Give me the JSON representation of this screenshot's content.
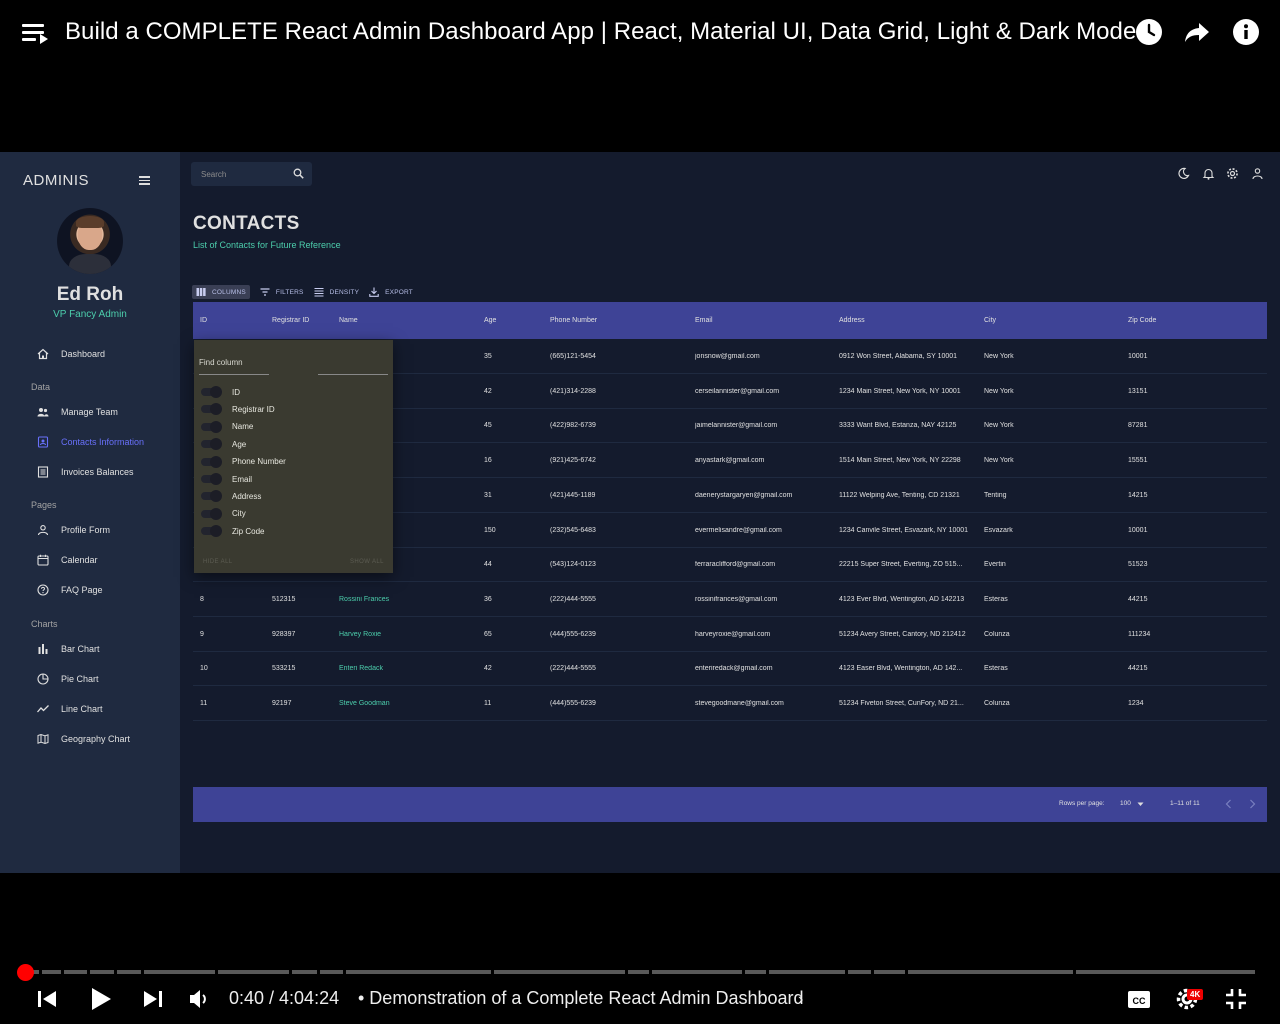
{
  "video": {
    "title": "Build a COMPLETE React Admin Dashboard App | React, Material UI, Data Grid, Light & Dark Mode",
    "current_time": "0:40",
    "duration": "4:04:24",
    "time_display": "0:40 / 4:04:24",
    "chapter": "• Demonstration of a Complete React Admin Dashboard",
    "chapter_chevron": "›",
    "quality_badge": "4K",
    "progress_fraction": 0.003,
    "accent_color": "#ff0000"
  },
  "app": {
    "brand": "ADMINIS",
    "user": {
      "name": "Ed Roh",
      "role": "VP Fancy Admin"
    },
    "nav": {
      "dashboard": "Dashboard",
      "section_data": "Data",
      "manage_team": "Manage Team",
      "contacts_information": "Contacts Information",
      "invoices_balances": "Invoices Balances",
      "section_pages": "Pages",
      "profile_form": "Profile Form",
      "calendar": "Calendar",
      "faq_page": "FAQ Page",
      "section_charts": "Charts",
      "bar_chart": "Bar Chart",
      "pie_chart": "Pie Chart",
      "line_chart": "Line Chart",
      "geography_chart": "Geography Chart"
    },
    "search": {
      "placeholder": "Search"
    },
    "page": {
      "title": "CONTACTS",
      "subtitle": "List of Contacts for Future Reference"
    },
    "toolbar": {
      "columns": "COLUMNS",
      "filters": "FILTERS",
      "density": "DENSITY",
      "export": "EXPORT"
    },
    "columns": [
      "ID",
      "Registrar ID",
      "Name",
      "Age",
      "Phone Number",
      "Email",
      "Address",
      "City",
      "Zip Code"
    ],
    "rows": [
      [
        "",
        "",
        "",
        "35",
        "(665)121-5454",
        "jonsnow@gmail.com",
        "0912 Won Street, Alabama, SY 10001",
        "New York",
        "10001"
      ],
      [
        "",
        "",
        "",
        "42",
        "(421)314-2288",
        "cerseilannister@gmail.com",
        "1234 Main Street, New York, NY 10001",
        "New York",
        "13151"
      ],
      [
        "",
        "",
        "",
        "45",
        "(422)982-6739",
        "jaimelannister@gmail.com",
        "3333 Want Blvd, Estanza, NAY 42125",
        "New York",
        "87281"
      ],
      [
        "",
        "",
        "",
        "16",
        "(921)425-6742",
        "anyastark@gmail.com",
        "1514 Main Street, New York, NY 22298",
        "New York",
        "15551"
      ],
      [
        "",
        "",
        "yen",
        "31",
        "(421)445-1189",
        "daenerystargaryen@gmail.com",
        "11122 Welping Ave, Tenting, CD 21321",
        "Tenting",
        "14215"
      ],
      [
        "",
        "",
        "",
        "150",
        "(232)545-6483",
        "evermelisandre@gmail.com",
        "1234 Canvile Street, Esvazark, NY 10001",
        "Esvazark",
        "10001"
      ],
      [
        "",
        "",
        "",
        "44",
        "(543)124-0123",
        "ferraraclifford@gmail.com",
        "22215 Super Street, Everting, ZO 515...",
        "Evertin",
        "51523"
      ],
      [
        "8",
        "512315",
        "Rossini Frances",
        "36",
        "(222)444-5555",
        "rossinifrances@gmail.com",
        "4123 Ever Blvd, Wentington, AD 142213",
        "Esteras",
        "44215"
      ],
      [
        "9",
        "928397",
        "Harvey Roxie",
        "65",
        "(444)555-6239",
        "harveyroxie@gmail.com",
        "51234 Avery Street, Cantory, ND 212412",
        "Colunza",
        "111234"
      ],
      [
        "10",
        "533215",
        "Enteri Redack",
        "42",
        "(222)444-5555",
        "enteriredack@gmail.com",
        "4123 Easer Blvd, Wentington, AD 142...",
        "Esteras",
        "44215"
      ],
      [
        "11",
        "92197",
        "Steve Goodman",
        "11",
        "(444)555-6239",
        "stevegoodmane@gmail.com",
        "51234 Fiveton Street, CunFory, ND 21...",
        "Colunza",
        "1234"
      ]
    ],
    "footer": {
      "rows_per_page_label": "Rows per page:",
      "rows_per_page": "100",
      "range": "1–11 of 11"
    },
    "column_panel": {
      "find_placeholder": "Find column",
      "options": [
        "ID",
        "Registrar ID",
        "Name",
        "Age",
        "Phone Number",
        "Email",
        "Address",
        "City",
        "Zip Code"
      ],
      "hide_all": "HIDE ALL",
      "show_all": "SHOW ALL"
    },
    "colors": {
      "background": "#141b2d",
      "panel": "#1f2a40",
      "grid_header": "#3e4396",
      "accent_green": "#4cceac",
      "accent_blue": "#6870fa"
    }
  }
}
